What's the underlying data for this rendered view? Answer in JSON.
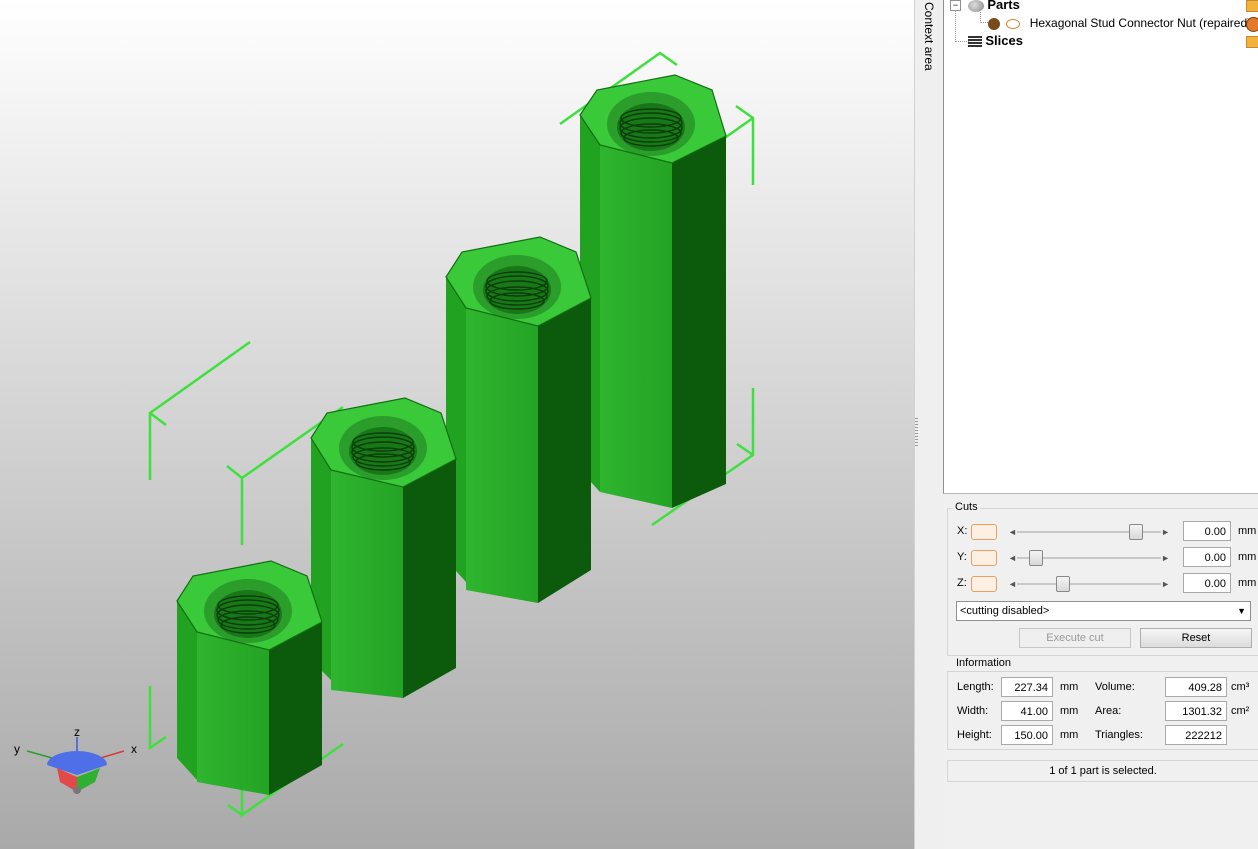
{
  "sidebar": {
    "context_area_label": "Context area",
    "tree": {
      "parts_label": "Parts",
      "part_name": "Hexagonal Stud Connector Nut (repaired)",
      "slices_label": "Slices"
    }
  },
  "cuts": {
    "title": "Cuts",
    "x_label": "X:",
    "x_value": "0.00",
    "x_level": 0.86,
    "y_label": "Y:",
    "y_value": "0.00",
    "y_level": 0.09,
    "z_label": "Z:",
    "z_value": "0.00",
    "z_level": 0.3,
    "unit": "mm",
    "mode_selected": "<cutting disabled>",
    "execute_label": "Execute cut",
    "reset_label": "Reset"
  },
  "information": {
    "title": "Information",
    "length_label": "Length:",
    "length_value": "227.34",
    "width_label": "Width:",
    "width_value": "41.00",
    "height_label": "Height:",
    "height_value": "150.00",
    "unit_mm": "mm",
    "volume_label": "Volume:",
    "volume_value": "409.28",
    "volume_unit": "cm³",
    "area_label": "Area:",
    "area_value": "1301.32",
    "area_unit": "cm²",
    "triangles_label": "Triangles:",
    "triangles_value": "222212"
  },
  "status": {
    "selection_text": "1 of 1 part is selected."
  },
  "axes": {
    "x": "x",
    "y": "y",
    "z": "z"
  },
  "colors": {
    "model_light": "#33c433",
    "model_mid": "#1e9e1e",
    "model_dark": "#0c5a0c",
    "bbox": "#3ee03e"
  }
}
